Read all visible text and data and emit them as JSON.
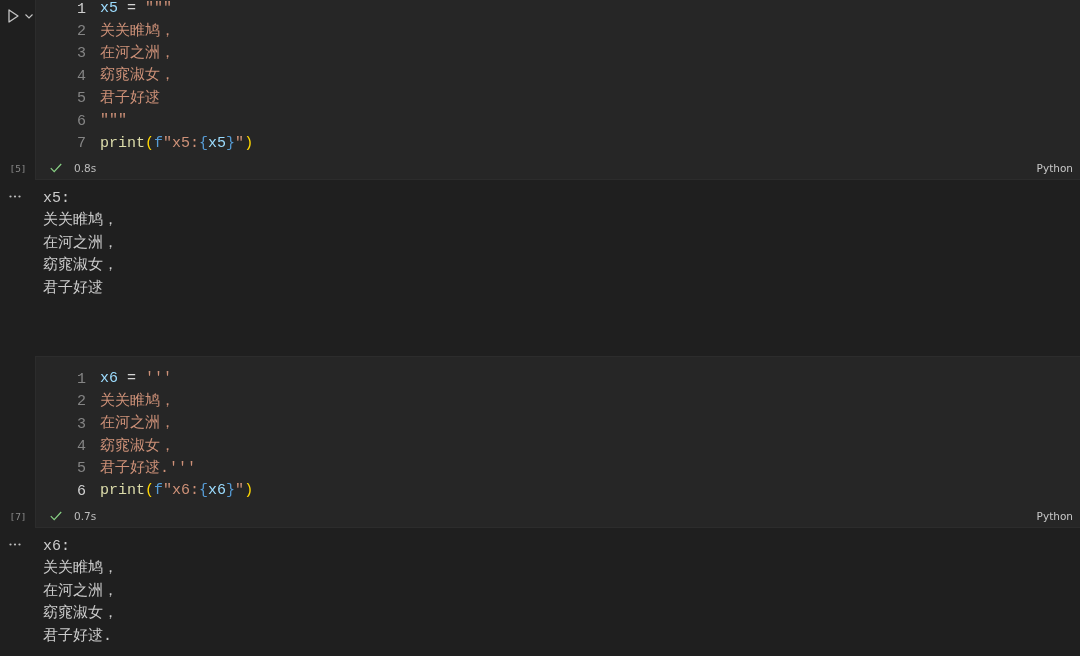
{
  "cells": [
    {
      "focused": true,
      "execution_count": "[5]",
      "success": true,
      "duration": "0.8s",
      "language": "Python",
      "lines": [
        {
          "number": "1",
          "current": true,
          "tokens": [
            {
              "kind": "variable",
              "text": "x5"
            },
            {
              "kind": "operator",
              "text": " = "
            },
            {
              "kind": "string",
              "text": "\"\"\""
            }
          ]
        },
        {
          "number": "2",
          "current": false,
          "tokens": [
            {
              "kind": "string",
              "text": "关关睢鸠，"
            }
          ]
        },
        {
          "number": "3",
          "current": false,
          "tokens": [
            {
              "kind": "string",
              "text": "在河之洲，"
            }
          ]
        },
        {
          "number": "4",
          "current": false,
          "tokens": [
            {
              "kind": "string",
              "text": "窈窕淑女，"
            }
          ]
        },
        {
          "number": "5",
          "current": false,
          "tokens": [
            {
              "kind": "string",
              "text": "君子好逑"
            }
          ]
        },
        {
          "number": "6",
          "current": false,
          "tokens": [
            {
              "kind": "string",
              "text": "\"\"\""
            }
          ]
        },
        {
          "number": "7",
          "current": false,
          "tokens": [
            {
              "kind": "function",
              "text": "print"
            },
            {
              "kind": "bracket",
              "text": "("
            },
            {
              "kind": "keyword",
              "text": "f"
            },
            {
              "kind": "string",
              "text": "\"x5:"
            },
            {
              "kind": "brace",
              "text": "{"
            },
            {
              "kind": "variable",
              "text": "x5"
            },
            {
              "kind": "brace",
              "text": "}"
            },
            {
              "kind": "string",
              "text": "\""
            },
            {
              "kind": "bracket",
              "text": ")"
            }
          ]
        }
      ],
      "output": [
        "x5:",
        "关关睢鸠，",
        "在河之洲，",
        "窈窕淑女，",
        "君子好逑"
      ]
    },
    {
      "focused": false,
      "execution_count": "[7]",
      "success": true,
      "duration": "0.7s",
      "language": "Python",
      "lines": [
        {
          "number": "1",
          "current": false,
          "tokens": [
            {
              "kind": "variable",
              "text": "x6"
            },
            {
              "kind": "operator",
              "text": " = "
            },
            {
              "kind": "string",
              "text": "'''"
            }
          ]
        },
        {
          "number": "2",
          "current": false,
          "tokens": [
            {
              "kind": "string",
              "text": "关关睢鸠，"
            }
          ]
        },
        {
          "number": "3",
          "current": false,
          "tokens": [
            {
              "kind": "string",
              "text": "在河之洲，"
            }
          ]
        },
        {
          "number": "4",
          "current": false,
          "tokens": [
            {
              "kind": "string",
              "text": "窈窕淑女，"
            }
          ]
        },
        {
          "number": "5",
          "current": false,
          "tokens": [
            {
              "kind": "string",
              "text": "君子好逑.'''"
            }
          ]
        },
        {
          "number": "6",
          "current": true,
          "tokens": [
            {
              "kind": "function",
              "text": "print"
            },
            {
              "kind": "bracket",
              "text": "("
            },
            {
              "kind": "keyword",
              "text": "f"
            },
            {
              "kind": "string",
              "text": "\"x6:"
            },
            {
              "kind": "brace",
              "text": "{"
            },
            {
              "kind": "variable",
              "text": "x6"
            },
            {
              "kind": "brace",
              "text": "}"
            },
            {
              "kind": "string",
              "text": "\""
            },
            {
              "kind": "bracket",
              "text": ")"
            }
          ]
        }
      ],
      "output": [
        "x6:",
        "关关睢鸠，",
        "在河之洲，",
        "窈窕淑女，",
        "君子好逑."
      ]
    }
  ]
}
